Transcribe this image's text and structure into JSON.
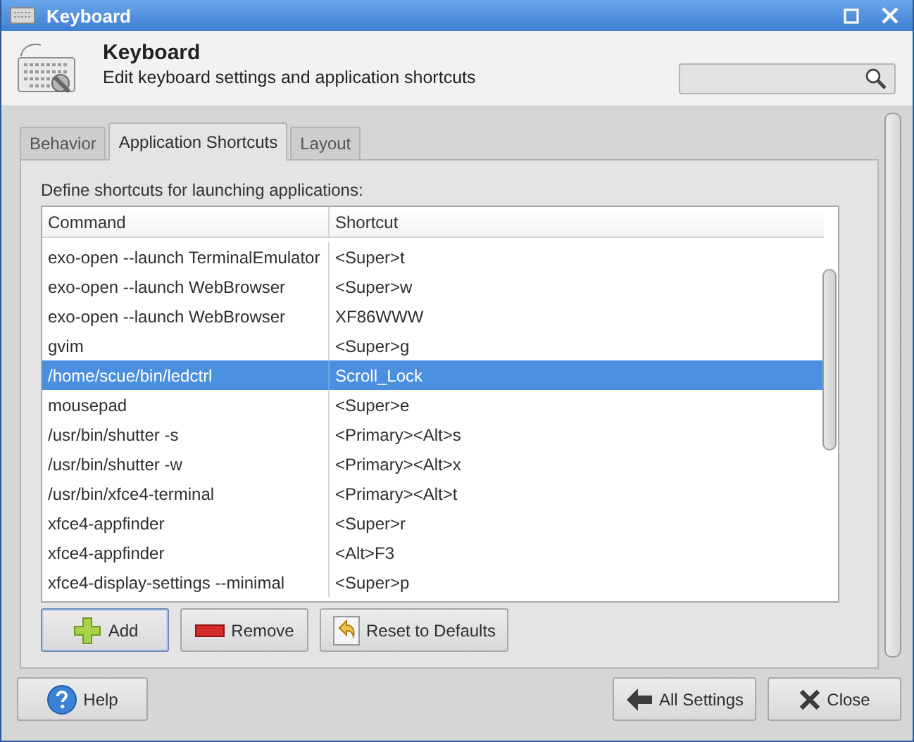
{
  "window": {
    "title": "Keyboard"
  },
  "header": {
    "title": "Keyboard",
    "subtitle": "Edit keyboard settings and application shortcuts"
  },
  "tabs": [
    {
      "label": "Behavior",
      "selected": false
    },
    {
      "label": "Application Shortcuts",
      "selected": true
    },
    {
      "label": "Layout",
      "selected": false
    }
  ],
  "shortcuts": {
    "description": "Define shortcuts for launching applications:",
    "columns": [
      "Command",
      "Shortcut"
    ],
    "rows": [
      {
        "command": "exo-open --launch TerminalEmulator",
        "shortcut": "<Super>t",
        "selected": false
      },
      {
        "command": "exo-open --launch WebBrowser",
        "shortcut": "<Super>w",
        "selected": false
      },
      {
        "command": "exo-open --launch WebBrowser",
        "shortcut": "XF86WWW",
        "selected": false
      },
      {
        "command": "gvim",
        "shortcut": "<Super>g",
        "selected": false
      },
      {
        "command": "/home/scue/bin/ledctrl",
        "shortcut": "Scroll_Lock",
        "selected": true
      },
      {
        "command": "mousepad",
        "shortcut": "<Super>e",
        "selected": false
      },
      {
        "command": "/usr/bin/shutter -s",
        "shortcut": "<Primary><Alt>s",
        "selected": false
      },
      {
        "command": "/usr/bin/shutter -w",
        "shortcut": "<Primary><Alt>x",
        "selected": false
      },
      {
        "command": "/usr/bin/xfce4-terminal",
        "shortcut": "<Primary><Alt>t",
        "selected": false
      },
      {
        "command": "xfce4-appfinder",
        "shortcut": "<Super>r",
        "selected": false
      },
      {
        "command": "xfce4-appfinder",
        "shortcut": "<Alt>F3",
        "selected": false
      },
      {
        "command": "xfce4-display-settings --minimal",
        "shortcut": "<Super>p",
        "selected": false
      }
    ]
  },
  "list_buttons": [
    {
      "label": "Add",
      "kind": "add",
      "focused": true
    },
    {
      "label": "Remove",
      "kind": "remove",
      "focused": false
    },
    {
      "label": "Reset to Defaults",
      "kind": "reset",
      "focused": false
    }
  ],
  "footer_buttons": [
    {
      "label": "Help",
      "kind": "help"
    },
    {
      "label": "All Settings",
      "kind": "back"
    },
    {
      "label": "Close",
      "kind": "close"
    }
  ]
}
